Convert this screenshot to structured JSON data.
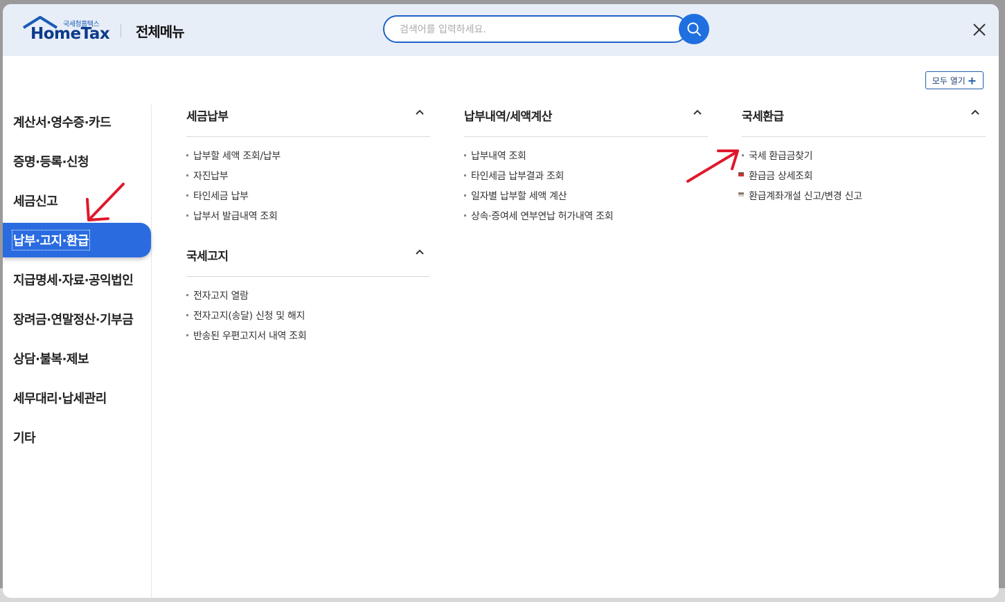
{
  "header": {
    "logo_small": "국세청홈택스",
    "logo_brand": "HomeTax",
    "title": "전체메뉴",
    "search_placeholder": "검색어를 입력하세요."
  },
  "open_all_label": "모두 열기",
  "left_nav": [
    {
      "label": "계산서·영수증·카드",
      "active": false
    },
    {
      "label": "증명·등록·신청",
      "active": false
    },
    {
      "label": "세금신고",
      "active": false
    },
    {
      "label": "납부·고지·환급",
      "active": true
    },
    {
      "label": "지급명세·자료·공익법인",
      "active": false
    },
    {
      "label": "장려금·연말정산·기부금",
      "active": false
    },
    {
      "label": "상담·불복·제보",
      "active": false
    },
    {
      "label": "세무대리·납세관리",
      "active": false
    },
    {
      "label": "기타",
      "active": false
    }
  ],
  "sections": [
    {
      "title": "세금납부",
      "items": [
        "납부할 세액 조회/납부",
        "자진납부",
        "타인세금 납부",
        "납부서 발급내역 조회"
      ]
    },
    {
      "title": "국세고지",
      "items": [
        "전자고지 열람",
        "전자고지(송달) 신청 및 해지",
        "반송된 우편고지서 내역 조회"
      ]
    },
    {
      "title": "납부내역/세액계산",
      "items": [
        "납부내역 조회",
        "타인세금 납부결과 조회",
        "일자별 납부할 세액 계산",
        "상속·증여세 연부연납 허가내역 조회"
      ]
    },
    {
      "title": "국세환급",
      "items": [
        "국세 환급금찾기",
        "환급금 상세조회",
        "환급계좌개설 신고/변경 신고"
      ]
    }
  ],
  "colors": {
    "accent": "#2a6ce0",
    "header_bg": "#e8eef8",
    "annotation_arrow": "#e0182d"
  }
}
